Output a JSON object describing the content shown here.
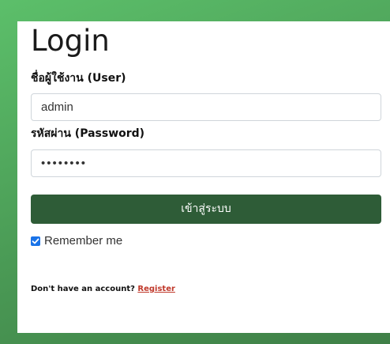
{
  "form": {
    "title": "Login",
    "username_label": "ชื่อผู้ใช้งาน (User)",
    "username_value": "admin",
    "password_label": "รหัสผ่าน (Password)",
    "password_value": "••••••••",
    "submit_label": "เข้าสู่ระบบ",
    "remember_label": "Remember me",
    "remember_checked": true,
    "signup_prompt": "Don't have an account?",
    "signup_link": "Register"
  },
  "colors": {
    "background_gradient_start": "#5cbf6a",
    "background_gradient_end": "#3f7f47",
    "button": "#2e5c37",
    "checkbox": "#1a73e8",
    "link": "#c0392b"
  },
  "icons": {
    "checkbox": "checkmark-icon"
  }
}
